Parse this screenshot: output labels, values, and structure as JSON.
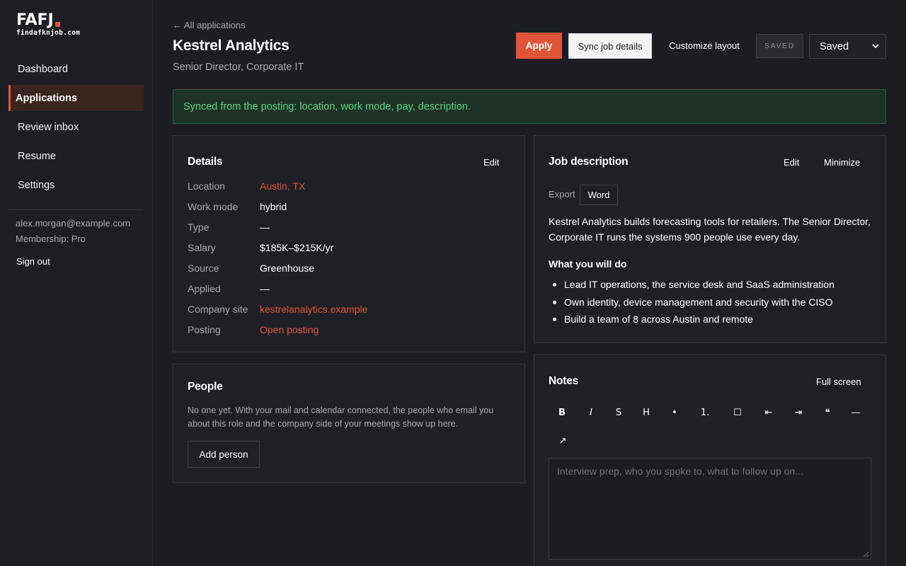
{
  "brand": {
    "name": "FAFJ",
    "domain": "findafknjob.com",
    "accent": "#e0543a"
  },
  "sidebar": {
    "items": [
      {
        "label": "Dashboard",
        "active": false
      },
      {
        "label": "Applications",
        "active": true
      },
      {
        "label": "Review inbox",
        "active": false
      },
      {
        "label": "Resume",
        "active": false
      },
      {
        "label": "Settings",
        "active": false
      }
    ],
    "email": "alex.morgan@example.com",
    "membership": "Membership: Pro",
    "sign_out": "Sign out"
  },
  "header": {
    "back_link": "← All applications",
    "company": "Kestrel Analytics",
    "role": "Senior Director, Corporate IT",
    "apply_label": "Apply",
    "sync_label": "Sync job details",
    "customize_label": "Customize layout",
    "status_badge": "SAVED",
    "status_select": "Saved"
  },
  "banner": {
    "text": "Synced from the posting: location, work mode, pay, description."
  },
  "details": {
    "title": "Details",
    "edit_label": "Edit",
    "rows": [
      {
        "label": "Location",
        "value": "Austin, TX",
        "link": true
      },
      {
        "label": "Work mode",
        "value": "hybrid",
        "link": false
      },
      {
        "label": "Type",
        "value": "—",
        "link": false
      },
      {
        "label": "Salary",
        "value": "$185K–$215K/yr",
        "link": false
      },
      {
        "label": "Source",
        "value": "Greenhouse",
        "link": false
      },
      {
        "label": "Applied",
        "value": "—",
        "link": false
      },
      {
        "label": "Company site",
        "value": "kestrelanalytics.example",
        "link": true
      },
      {
        "label": "Posting",
        "value": "Open posting",
        "link": true
      }
    ]
  },
  "people": {
    "title": "People",
    "empty_text": "No one yet. With your mail and calendar connected, the people who email you about this role and the company side of your meetings show up here.",
    "add_label": "Add person"
  },
  "job_description": {
    "title": "Job description",
    "edit_label": "Edit",
    "minimize_label": "Minimize",
    "export_label": "Export",
    "word_label": "Word",
    "intro": "Kestrel Analytics builds forecasting tools for retailers. The Senior Director, Corporate IT runs the systems 900 people use every day.",
    "subheading": "What you will do",
    "bullets": [
      "Lead IT operations, the service desk and SaaS administration",
      "Own identity, device management and security with the CISO",
      "Build a team of 8 across Austin and remote"
    ]
  },
  "notes": {
    "title": "Notes",
    "fullscreen_label": "Full screen",
    "toolbar": [
      {
        "name": "bold-button",
        "glyph": "B"
      },
      {
        "name": "italic-button",
        "glyph": "I"
      },
      {
        "name": "strikethrough-button",
        "glyph": "S"
      },
      {
        "name": "heading-button",
        "glyph": "H"
      },
      {
        "name": "bullet-list-button",
        "glyph": "•"
      },
      {
        "name": "numbered-list-button",
        "glyph": "1."
      },
      {
        "name": "checkbox-button",
        "glyph": "☐"
      },
      {
        "name": "outdent-button",
        "glyph": "⇤"
      },
      {
        "name": "indent-button",
        "glyph": "⇥"
      },
      {
        "name": "quote-button",
        "glyph": "❝"
      },
      {
        "name": "divider-button",
        "glyph": "—"
      },
      {
        "name": "link-button",
        "glyph": "↗"
      }
    ],
    "placeholder": "Interview prep, who you spoke to, what to follow up on..."
  }
}
